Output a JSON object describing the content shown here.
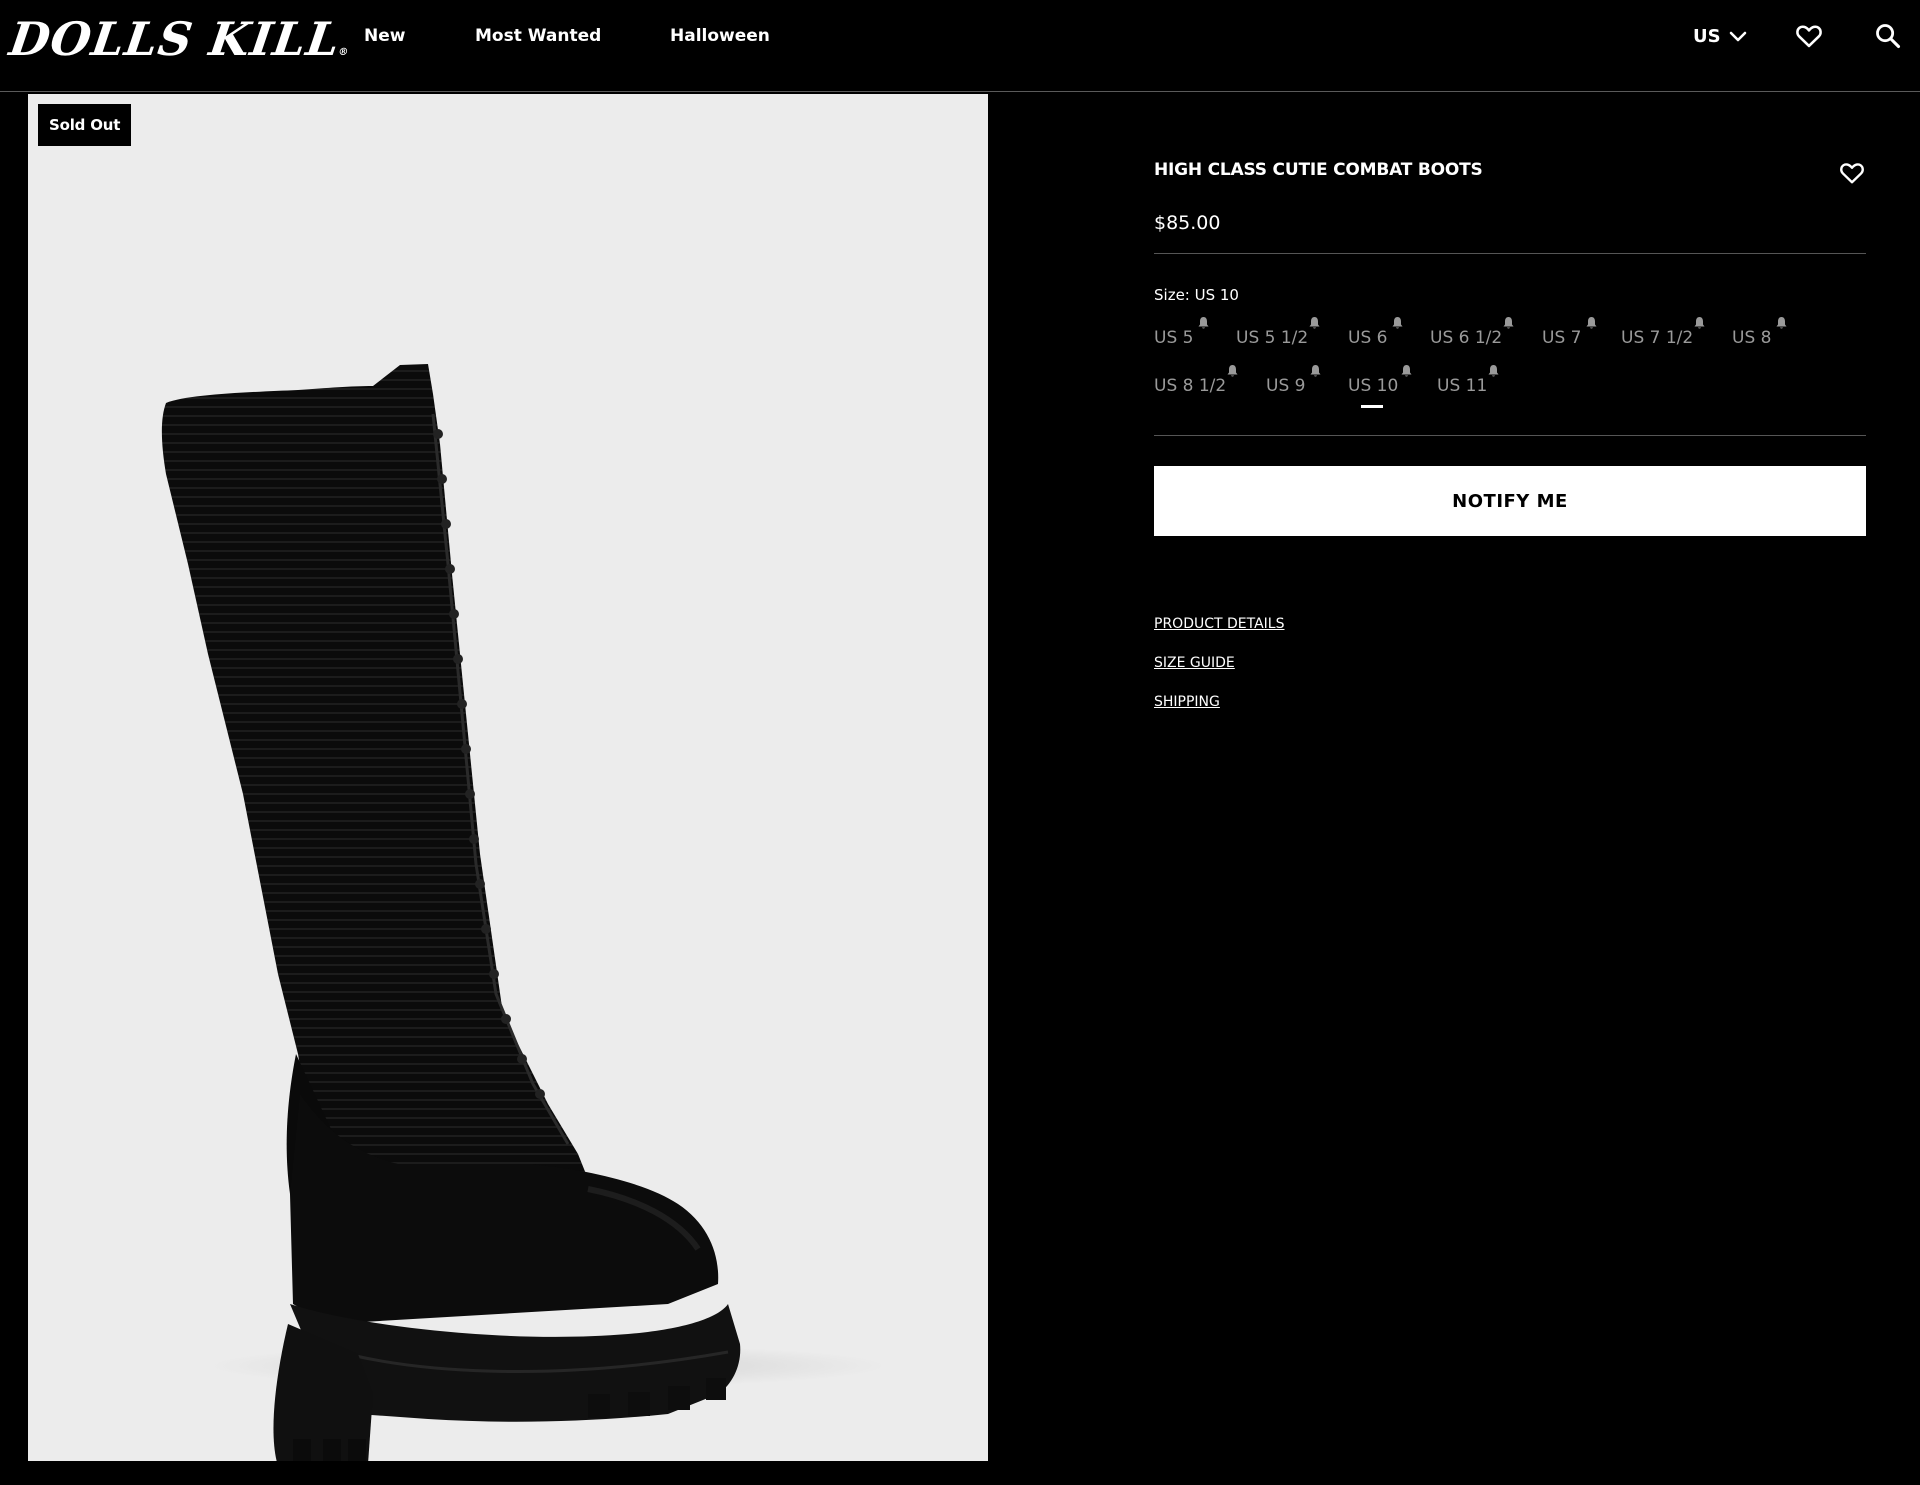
{
  "header": {
    "logo": "DOLLS KILL",
    "logo_mark": "®",
    "nav": [
      "New",
      "Most Wanted",
      "Halloween"
    ],
    "region": "US",
    "icons": {
      "region_toggle": "chevron-down-icon",
      "wishlist": "heart-icon",
      "search": "search-icon"
    }
  },
  "gallery": {
    "badge": "Sold Out",
    "background_color": "#ececec"
  },
  "product": {
    "title": "HIGH CLASS CUTIE COMBAT BOOTS",
    "price": "$85.00",
    "size_label": "Size: US 10",
    "sizes": [
      {
        "label": "US 5",
        "sold_out": true
      },
      {
        "label": "US 5 1/2",
        "sold_out": true
      },
      {
        "label": "US 6",
        "sold_out": true
      },
      {
        "label": "US 6 1/2",
        "sold_out": true
      },
      {
        "label": "US 7",
        "sold_out": true
      },
      {
        "label": "US 7 1/2",
        "sold_out": true
      },
      {
        "label": "US 8",
        "sold_out": true
      },
      {
        "label": "US 8 1/2",
        "sold_out": true
      },
      {
        "label": "US 9",
        "sold_out": true
      },
      {
        "label": "US 10",
        "sold_out": true,
        "selected": true
      },
      {
        "label": "US 11",
        "sold_out": true
      }
    ],
    "notify_button": "NOTIFY ME",
    "links": [
      "PRODUCT DETAILS",
      "SIZE GUIDE",
      "SHIPPING"
    ],
    "colors": {
      "page_bg": "#000000",
      "unavailable_size": "#9a9a9a",
      "button_bg": "#ffffff"
    }
  }
}
